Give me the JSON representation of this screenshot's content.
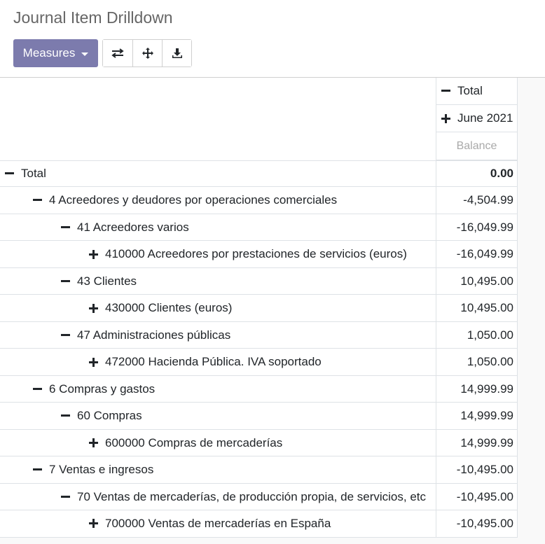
{
  "header": {
    "title": "Journal Item Drilldown",
    "measures_label": "Measures",
    "buttons": [
      {
        "name": "flip-axis",
        "icon": "exchange-icon"
      },
      {
        "name": "expand-all",
        "icon": "arrows-icon"
      },
      {
        "name": "download",
        "icon": "download-icon"
      }
    ]
  },
  "pivot": {
    "col_header_total": "Total",
    "col_header_period": "June 2021",
    "measure": "Balance",
    "rows": [
      {
        "label": "Total",
        "value": "0.00",
        "level": 0,
        "expanded": true,
        "bold": true
      },
      {
        "label": "4 Acreedores y deudores por operaciones comerciales",
        "value": "-4,504.99",
        "level": 1,
        "expanded": true
      },
      {
        "label": "41 Acreedores varios",
        "value": "-16,049.99",
        "level": 2,
        "expanded": true
      },
      {
        "label": "410000 Acreedores por prestaciones de servicios (euros)",
        "value": "-16,049.99",
        "level": 3,
        "expanded": false
      },
      {
        "label": "43 Clientes",
        "value": "10,495.00",
        "level": 2,
        "expanded": true
      },
      {
        "label": "430000 Clientes (euros)",
        "value": "10,495.00",
        "level": 3,
        "expanded": false
      },
      {
        "label": "47 Administraciones públicas",
        "value": "1,050.00",
        "level": 2,
        "expanded": true
      },
      {
        "label": "472000 Hacienda Pública. IVA soportado",
        "value": "1,050.00",
        "level": 3,
        "expanded": false
      },
      {
        "label": "6 Compras y gastos",
        "value": "14,999.99",
        "level": 1,
        "expanded": true
      },
      {
        "label": "60 Compras",
        "value": "14,999.99",
        "level": 2,
        "expanded": true
      },
      {
        "label": "600000 Compras de mercaderías",
        "value": "14,999.99",
        "level": 3,
        "expanded": false
      },
      {
        "label": "7 Ventas e ingresos",
        "value": "-10,495.00",
        "level": 1,
        "expanded": true
      },
      {
        "label": "70 Ventas de mercaderías, de producción propia, de servicios, etc",
        "value": "-10,495.00",
        "level": 2,
        "expanded": true
      },
      {
        "label": "700000 Ventas de mercaderías en España",
        "value": "-10,495.00",
        "level": 3,
        "expanded": false
      }
    ]
  }
}
